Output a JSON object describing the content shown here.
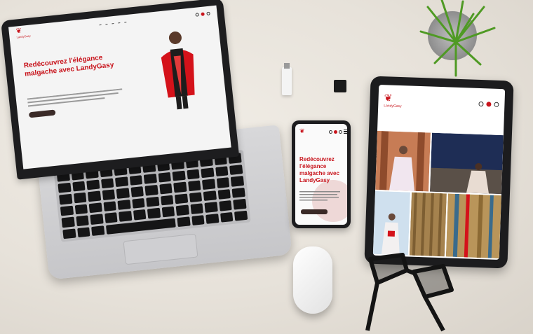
{
  "colors": {
    "brand_red": "#c8141c",
    "button_dark": "#3a2a27",
    "device_dark": "#1c1c1e",
    "desk": "#e7e2da"
  },
  "brand": {
    "logo_text": "LandyGasy"
  },
  "laptop_site": {
    "hero_title": "Redécouvrez l'élégance malgache avec LandyGasy"
  },
  "phone_site": {
    "hero_title": "Redécouvrez l'élégance malgache avec LandyGasy"
  },
  "icons": [
    "search-icon",
    "cart-icon",
    "user-icon",
    "menu-icon"
  ]
}
